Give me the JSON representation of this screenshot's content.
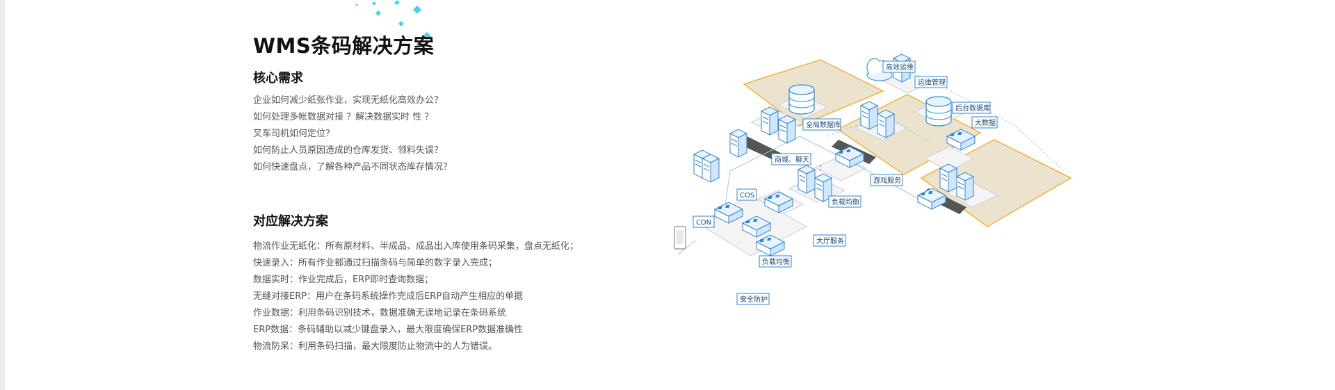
{
  "title": "WMS条码解决方案",
  "needs": {
    "heading": "核心需求",
    "items": [
      "企业如何减少纸张作业，实现无纸化高效办公？",
      "如何处理多帐数据对接 ？解决数据实时 性 ？",
      "叉车司机如何定位？",
      "如何防止人员原因造成的仓库发货、领料失误？",
      "如何快速盘点，了解各种产品不同状态库存情况？"
    ]
  },
  "solutions": {
    "heading": "对应解决方案",
    "items": [
      "物流作业无纸化：所有原材料、半成品、成品出入库使用条码采集，盘点无纸化；",
      "快速录入：所有作业都通过扫描条码与简单的数字录入完成；",
      "数据实时：作业完成后，ERP即时查询数据；",
      "无缝对接ERP：用户在条码系统操作完成后ERP自动产生相应的单据",
      "作业数据：利用条码识别技术，数据准确无误地记录在条码系统",
      "ERP数据：条码辅助以减少键盘录入，最大限度确保ERP数据准确性",
      "物流防呆：利用条码扫描，最大限度防止物流中的人为错误。"
    ]
  },
  "diagram": {
    "labels": {
      "efficient_ops": "高效运维",
      "ops_management": "运维管理",
      "backend_db": "后台数据库",
      "global_db": "全局数据库",
      "big_data": "大数据",
      "mall_chat": "商城、聊天",
      "game_service": "游戏服务",
      "cos": "COS",
      "cdn": "CDN",
      "load_balance_1": "负载均衡",
      "load_balance_2": "负载均衡",
      "hall_service": "大厅服务",
      "security": "安全防护"
    },
    "colors": {
      "accent_blue": "#2c86d6",
      "zone_fill": "#ece3cf",
      "zone_border": "#f2b23a",
      "decor_cyan": "#49d3e6"
    }
  }
}
